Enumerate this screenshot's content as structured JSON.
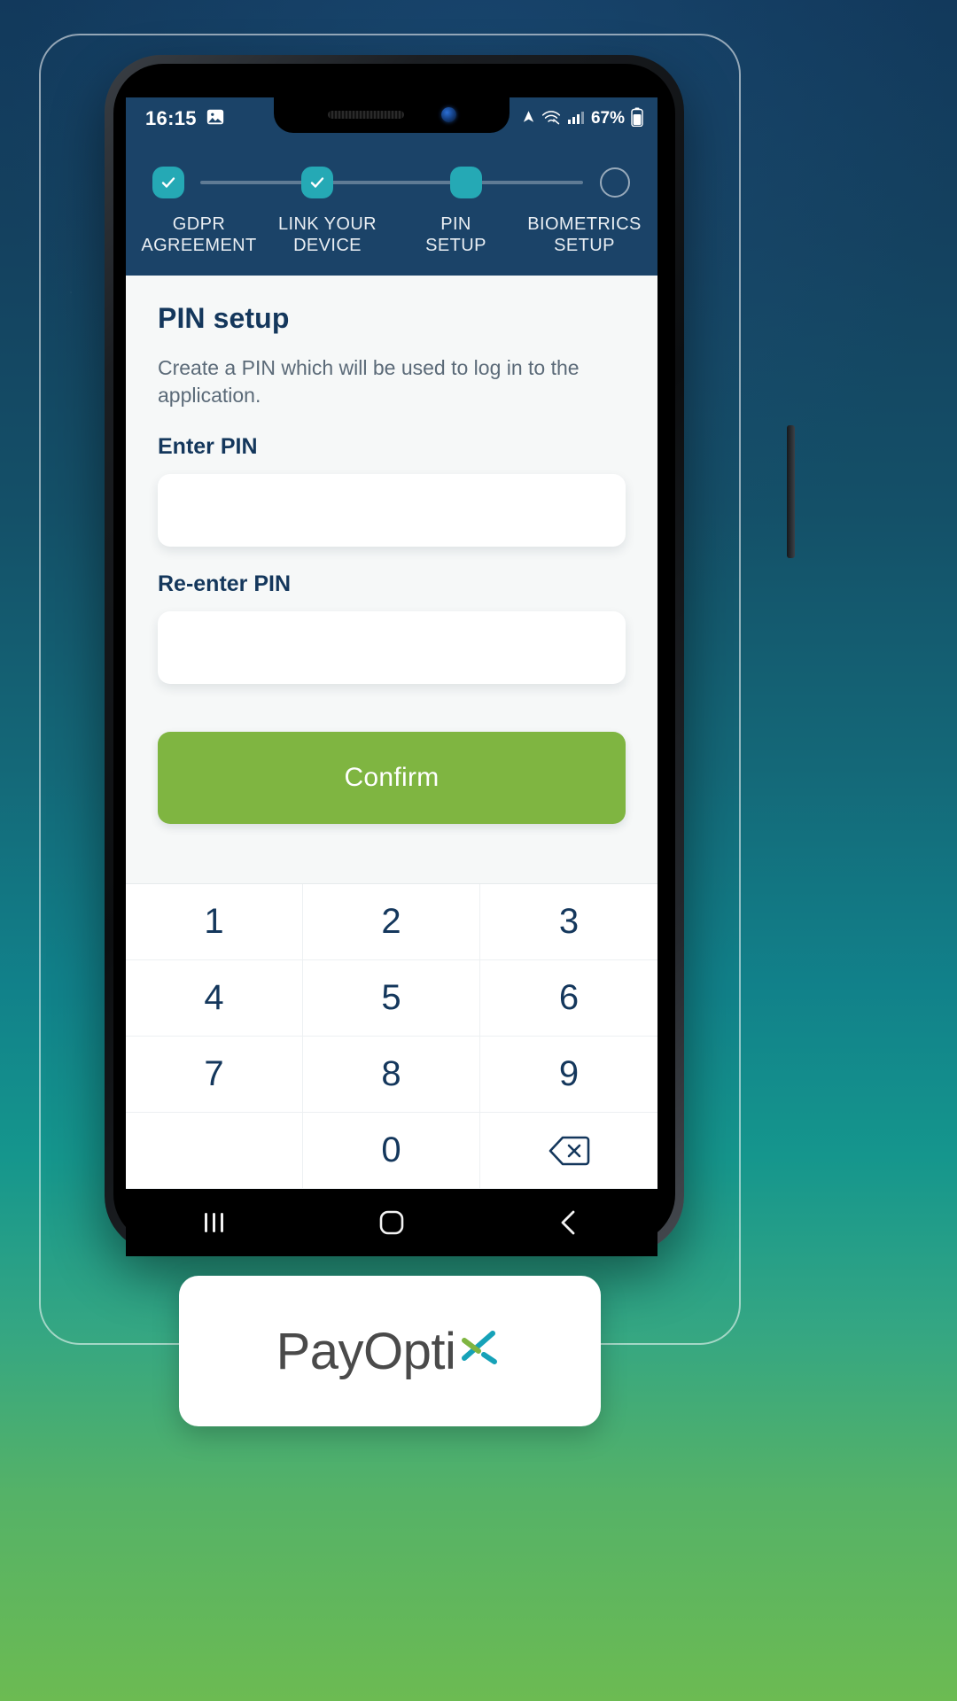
{
  "status_bar": {
    "time": "16:15",
    "left_icons": [
      "image-icon"
    ],
    "battery_percent": "67%",
    "right_icons": [
      "location-icon",
      "wifi-calling-icon",
      "signal-icon",
      "battery-icon"
    ]
  },
  "stepper": {
    "steps": [
      {
        "label": "GDPR\nAGREEMENT",
        "line1": "GDPR",
        "line2": "AGREEMENT",
        "state": "done"
      },
      {
        "label": "LINK YOUR\nDEVICE",
        "line1": "LINK YOUR",
        "line2": "DEVICE",
        "state": "done"
      },
      {
        "label": "PIN\nSETUP",
        "line1": "PIN",
        "line2": "SETUP",
        "state": "current"
      },
      {
        "label": "BIOMETRICS\nSETUP",
        "line1": "BIOMETRICS",
        "line2": "SETUP",
        "state": "todo"
      }
    ]
  },
  "content": {
    "title": "PIN setup",
    "description": "Create a PIN which will be used to log in to the application.",
    "enter_pin_label": "Enter PIN",
    "enter_pin_value": "",
    "enter_pin_placeholder": "",
    "reenter_pin_label": "Re-enter PIN",
    "reenter_pin_value": "",
    "reenter_pin_placeholder": "",
    "confirm_label": "Confirm"
  },
  "keypad": {
    "keys": [
      "1",
      "2",
      "3",
      "4",
      "5",
      "6",
      "7",
      "8",
      "9",
      "",
      "0",
      "backspace"
    ]
  },
  "nav_bar": {
    "recents_label": "recent-apps",
    "home_label": "home",
    "back_label": "back"
  },
  "logo": {
    "text_primary": "PayOpti",
    "text_mark": "x",
    "full": "PayOptix"
  },
  "colors": {
    "header_navy": "#1b4368",
    "accent_teal": "#25a9b5",
    "confirm_green": "#7fb541",
    "text_navy": "#14375c",
    "body_gray": "#5b6a78",
    "screen_bg": "#f6f8f8",
    "logo_gray": "#4a4a4a",
    "logo_teal": "#16a2b8",
    "logo_green": "#7fb541"
  }
}
